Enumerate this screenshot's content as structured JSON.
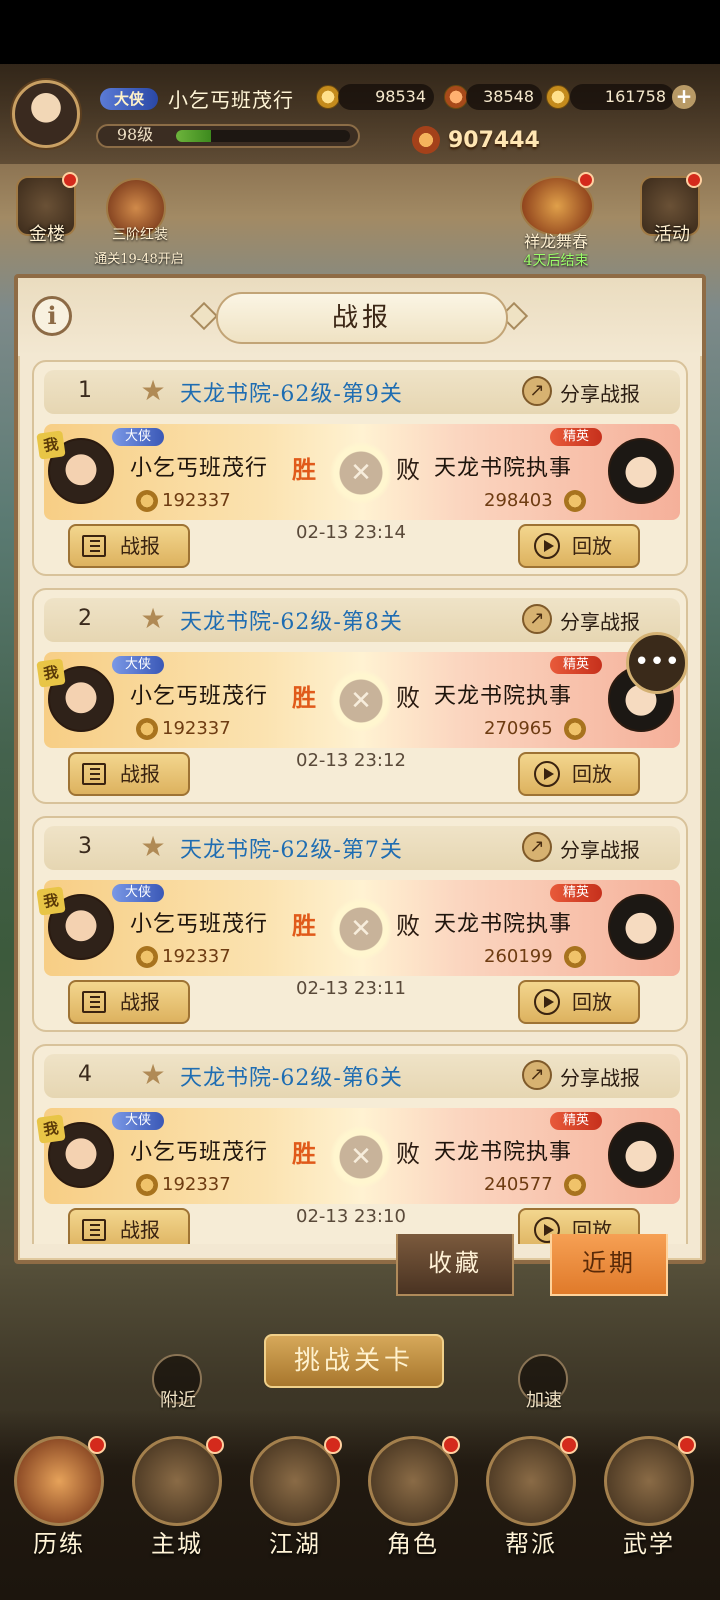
{
  "player": {
    "rank_tag": "大侠",
    "name": "小乞丐班茂行",
    "level": "98级",
    "power": "907444"
  },
  "resources": {
    "coins": "98534",
    "stamina": "38548",
    "gold": "161758"
  },
  "side": {
    "left1_label": "金楼",
    "left2_label": "三阶红装",
    "left2_sub": "通关19-48开启",
    "right1_label": "祥龙舞春",
    "right1_sub": "4天后结束",
    "right2_label": "活动"
  },
  "panel": {
    "title": "战报",
    "info_glyph": "i"
  },
  "reports": [
    {
      "index": "1",
      "stage": "天龙书院-62级-第9关",
      "share": "分享战报",
      "me_tag": "我",
      "me_rank": "大侠",
      "me_name": "小乞丐班茂行",
      "me_power": "192337",
      "win": "胜",
      "lose": "败",
      "foe_rank": "精英",
      "foe_name": "天龙书院执事",
      "foe_power": "298403",
      "time": "02-13 23:14",
      "report_btn": "战报",
      "replay_btn": "回放"
    },
    {
      "index": "2",
      "stage": "天龙书院-62级-第8关",
      "share": "分享战报",
      "me_tag": "我",
      "me_rank": "大侠",
      "me_name": "小乞丐班茂行",
      "me_power": "192337",
      "win": "胜",
      "lose": "败",
      "foe_rank": "精英",
      "foe_name": "天龙书院执事",
      "foe_power": "270965",
      "time": "02-13 23:12",
      "report_btn": "战报",
      "replay_btn": "回放"
    },
    {
      "index": "3",
      "stage": "天龙书院-62级-第7关",
      "share": "分享战报",
      "me_tag": "我",
      "me_rank": "大侠",
      "me_name": "小乞丐班茂行",
      "me_power": "192337",
      "win": "胜",
      "lose": "败",
      "foe_rank": "精英",
      "foe_name": "天龙书院执事",
      "foe_power": "260199",
      "time": "02-13 23:11",
      "report_btn": "战报",
      "replay_btn": "回放"
    },
    {
      "index": "4",
      "stage": "天龙书院-62级-第6关",
      "share": "分享战报",
      "me_tag": "我",
      "me_rank": "大侠",
      "me_name": "小乞丐班茂行",
      "me_power": "192337",
      "win": "胜",
      "lose": "败",
      "foe_rank": "精英",
      "foe_name": "天龙书院执事",
      "foe_power": "240577",
      "time": "02-13 23:10",
      "report_btn": "战报",
      "replay_btn": "回放"
    }
  ],
  "tabs": {
    "favorites": "收藏",
    "recent": "近期"
  },
  "actions": {
    "nearby": "附近",
    "challenge": "挑战关卡",
    "speedup": "加速"
  },
  "nav": [
    {
      "label": "历练"
    },
    {
      "label": "主城"
    },
    {
      "label": "江湖"
    },
    {
      "label": "角色"
    },
    {
      "label": "帮派"
    },
    {
      "label": "武学"
    }
  ]
}
